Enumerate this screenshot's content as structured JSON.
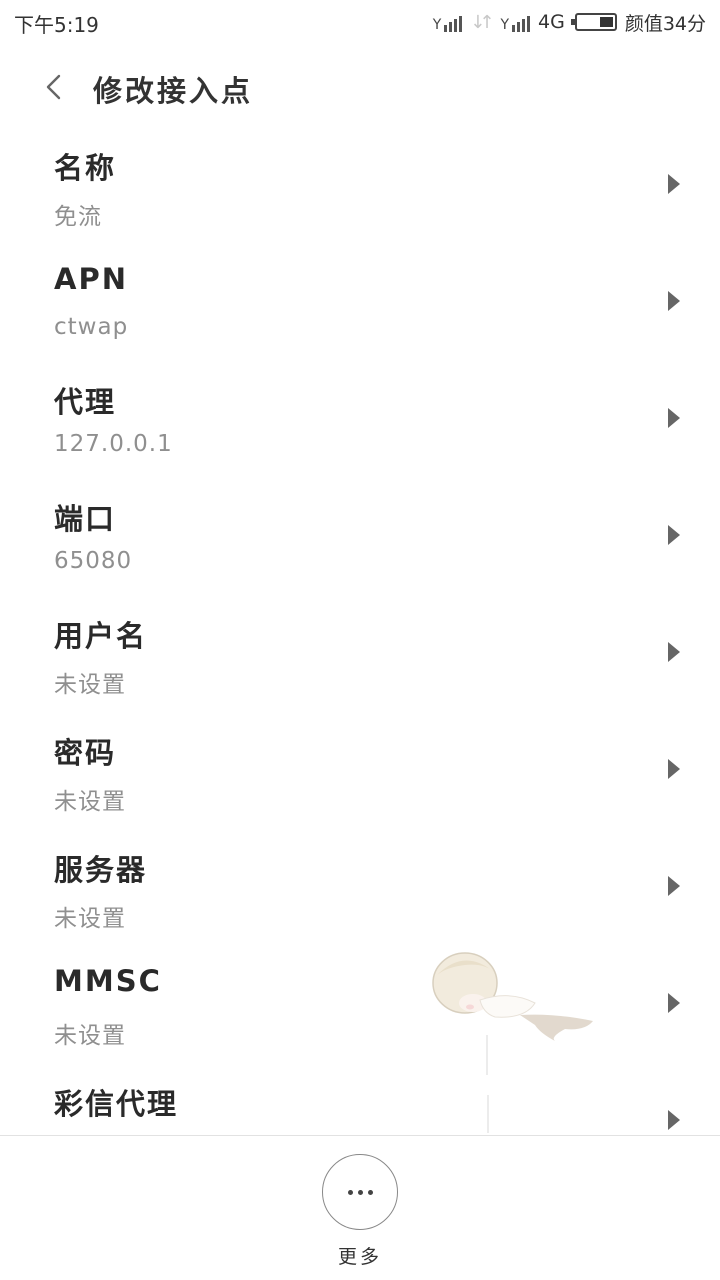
{
  "status_bar": {
    "time": "下午5:19",
    "network": "4G",
    "battery_text": "颜值34分",
    "signal_icon": "signal-icon",
    "data_icon": "data-arrows-icon",
    "battery_icon": "battery-icon"
  },
  "header": {
    "title": "修改接入点",
    "back_icon": "chevron-left-icon"
  },
  "fields": [
    {
      "label": "名称",
      "value": "免流"
    },
    {
      "label": "APN",
      "value": "ctwap"
    },
    {
      "label": "代理",
      "value": "127.0.0.1"
    },
    {
      "label": "端口",
      "value": "65080"
    },
    {
      "label": "用户名",
      "value": "未设置"
    },
    {
      "label": "密码",
      "value": "未设置"
    },
    {
      "label": "服务器",
      "value": "未设置"
    },
    {
      "label": "MMSC",
      "value": "未设置"
    },
    {
      "label": "彩信代理",
      "value": ""
    }
  ],
  "bottom_bar": {
    "more_label": "更多",
    "more_icon": "more-dots-icon"
  },
  "colors": {
    "label": "#2a2a2a",
    "value": "#8f8f8f",
    "chevron": "#666666",
    "divider": "#e2e2e2"
  }
}
